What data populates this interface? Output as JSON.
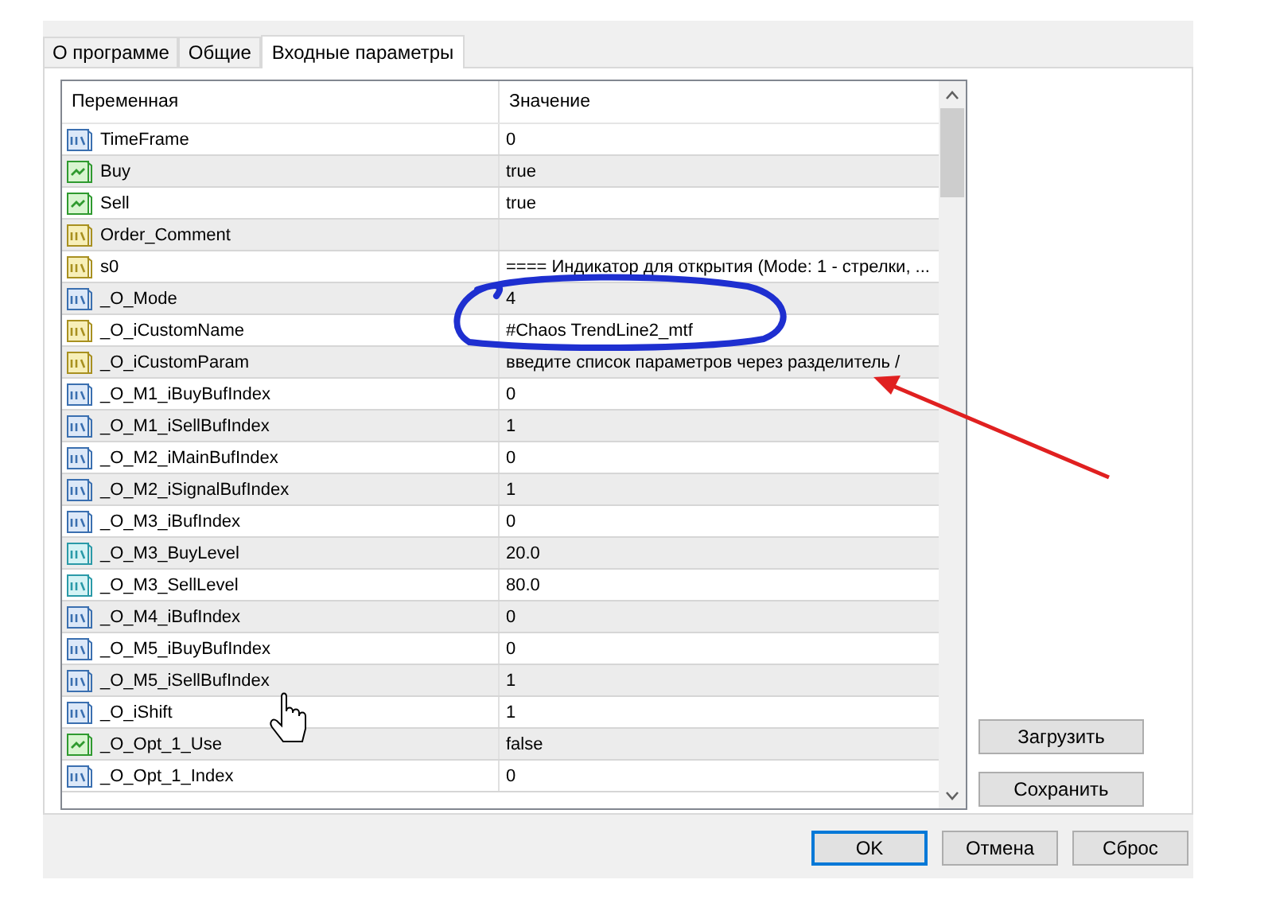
{
  "tabs": [
    {
      "label": "О программе",
      "selected": false
    },
    {
      "label": "Общие",
      "selected": false
    },
    {
      "label": "Входные параметры",
      "selected": true
    }
  ],
  "table": {
    "columns": [
      "Переменная",
      "Значение"
    ],
    "rows": [
      {
        "kind": "int",
        "name": "TimeFrame",
        "value": "0"
      },
      {
        "kind": "bool",
        "name": "Buy",
        "value": "true"
      },
      {
        "kind": "bool",
        "name": "Sell",
        "value": "true"
      },
      {
        "kind": "string",
        "name": "Order_Comment",
        "value": ""
      },
      {
        "kind": "string",
        "name": "s0",
        "value": "==== Индикатор для открытия (Mode: 1 - стрелки, ..."
      },
      {
        "kind": "int",
        "name": "_O_Mode",
        "value": "4"
      },
      {
        "kind": "string",
        "name": "_O_iCustomName",
        "value": "#Chaos TrendLine2_mtf"
      },
      {
        "kind": "string",
        "name": "_O_iCustomParam",
        "value": "введите список параметров через разделитель /"
      },
      {
        "kind": "int",
        "name": "_O_M1_iBuyBufIndex",
        "value": "0"
      },
      {
        "kind": "int",
        "name": "_O_M1_iSellBufIndex",
        "value": "1"
      },
      {
        "kind": "int",
        "name": "_O_M2_iMainBufIndex",
        "value": "0"
      },
      {
        "kind": "int",
        "name": "_O_M2_iSignalBufIndex",
        "value": "1"
      },
      {
        "kind": "int",
        "name": "_O_M3_iBufIndex",
        "value": "0"
      },
      {
        "kind": "double",
        "name": "_O_M3_BuyLevel",
        "value": "20.0"
      },
      {
        "kind": "double",
        "name": "_O_M3_SellLevel",
        "value": "80.0"
      },
      {
        "kind": "int",
        "name": "_O_M4_iBufIndex",
        "value": "0"
      },
      {
        "kind": "int",
        "name": "_O_M5_iBuyBufIndex",
        "value": "0"
      },
      {
        "kind": "int",
        "name": "_O_M5_iSellBufIndex",
        "value": "1"
      },
      {
        "kind": "int",
        "name": "_O_iShift",
        "value": "1"
      },
      {
        "kind": "bool",
        "name": "_O_Opt_1_Use",
        "value": "false"
      },
      {
        "kind": "int",
        "name": "_O_Opt_1_Index",
        "value": "0"
      }
    ]
  },
  "side_buttons": [
    "Загрузить",
    "Сохранить"
  ],
  "buttons": [
    {
      "label": "OK",
      "default": true
    },
    {
      "label": "Отмена",
      "default": false
    },
    {
      "label": "Сброс",
      "default": false
    }
  ]
}
